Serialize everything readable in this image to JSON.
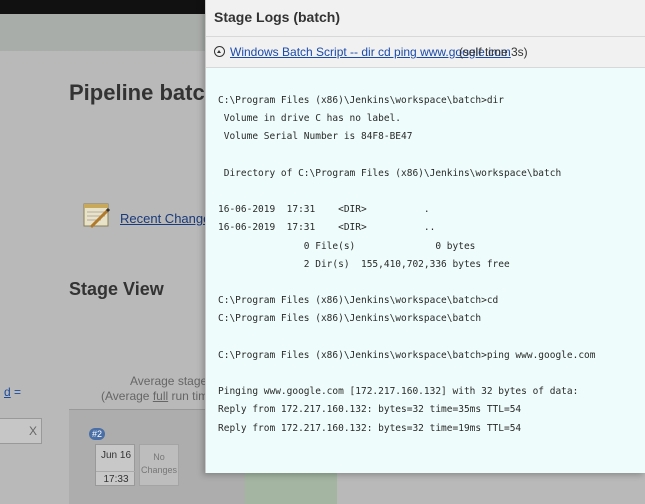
{
  "background": {
    "title": "Pipeline batch",
    "recent_changes": "Recent Changes",
    "stage_view": "Stage View",
    "avg_line1": "Average stage",
    "avg_line2_pre": "(Average ",
    "avg_line2_link": "full",
    "avg_line2_post": " run time",
    "left_link": "d",
    "left_link_suffix": " =",
    "filter_clear": "X",
    "build_number": "#2",
    "build_date": "Jun 16",
    "build_time": "17:33",
    "no_changes_line1": "No",
    "no_changes_line2": "Changes"
  },
  "modal": {
    "title": "Stage Logs (batch)",
    "step_link": "Windows Batch Script -- dir cd ping www.google.com",
    "step_self_time": "(self time 3s)",
    "log_lines": [
      "C:\\Program Files (x86)\\Jenkins\\workspace\\batch>dir",
      " Volume in drive C has no label.",
      " Volume Serial Number is 84F8-BE47",
      "",
      " Directory of C:\\Program Files (x86)\\Jenkins\\workspace\\batch",
      "",
      "16-06-2019  17:31    <DIR>          .",
      "16-06-2019  17:31    <DIR>          ..",
      "               0 File(s)              0 bytes",
      "               2 Dir(s)  155,410,702,336 bytes free",
      "",
      "C:\\Program Files (x86)\\Jenkins\\workspace\\batch>cd",
      "C:\\Program Files (x86)\\Jenkins\\workspace\\batch",
      "",
      "C:\\Program Files (x86)\\Jenkins\\workspace\\batch>ping www.google.com",
      "",
      "Pinging www.google.com [172.217.160.132] with 32 bytes of data:",
      "Reply from 172.217.160.132: bytes=32 time=35ms TTL=54",
      "Reply from 172.217.160.132: bytes=32 time=19ms TTL=54"
    ]
  }
}
